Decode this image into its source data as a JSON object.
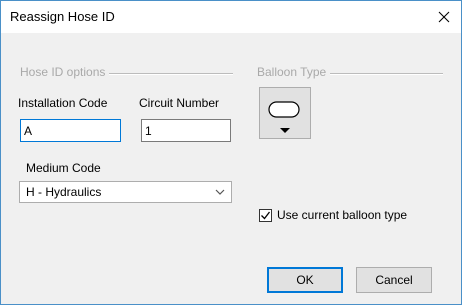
{
  "dialog": {
    "title": "Reassign Hose ID",
    "close_icon": "close-icon"
  },
  "hose_id_options": {
    "group_label": "Hose ID options",
    "installation_code": {
      "label": "Installation Code",
      "value": "A"
    },
    "circuit_number": {
      "label": "Circuit Number",
      "value": "1"
    },
    "medium_code": {
      "label": "Medium Code",
      "selected": "H - Hydraulics",
      "dropdown_icon": "chevron-down-icon"
    }
  },
  "balloon_type": {
    "group_label": "Balloon Type",
    "button_icon": "balloon-shape-icon",
    "dropdown_icon": "triangle-down-icon"
  },
  "use_current_balloon": {
    "label": "Use current balloon type",
    "checked": true
  },
  "buttons": {
    "ok": "OK",
    "cancel": "Cancel"
  },
  "colors": {
    "window_border": "#4a90c8",
    "focus_border": "#0078d7",
    "disabled_text": "#a9a9a9",
    "dialog_bg": "#f0f0f0"
  }
}
